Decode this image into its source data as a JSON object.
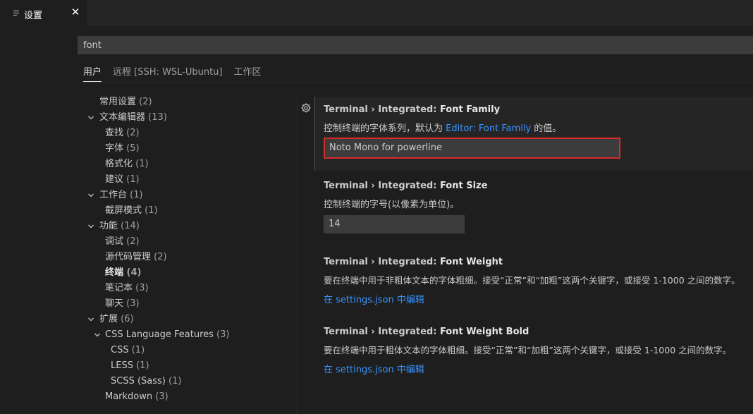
{
  "tab": {
    "label": "设置",
    "icon": "settings-list-icon",
    "close": "✕"
  },
  "search": {
    "value": "font"
  },
  "scopes": [
    {
      "label": "用户",
      "active": true
    },
    {
      "label": "远程 [SSH: WSL-Ubuntu]",
      "active": false
    },
    {
      "label": "工作区",
      "active": false
    }
  ],
  "toc": {
    "items": [
      {
        "label": "常用设置",
        "count": "(2)"
      },
      {
        "label": "文本编辑器",
        "count": "(13)",
        "chevron": "expanded"
      },
      {
        "label": "查找",
        "count": "(2)"
      },
      {
        "label": "字体",
        "count": "(5)"
      },
      {
        "label": "格式化",
        "count": "(1)"
      },
      {
        "label": "建议",
        "count": "(1)"
      },
      {
        "label": "工作台",
        "count": "(1)",
        "chevron": "expanded"
      },
      {
        "label": "截屏模式",
        "count": "(1)"
      },
      {
        "label": "功能",
        "count": "(14)",
        "chevron": "expanded"
      },
      {
        "label": "调试",
        "count": "(2)"
      },
      {
        "label": "源代码管理",
        "count": "(2)"
      },
      {
        "label": "终端",
        "count": "(4)",
        "selected": true
      },
      {
        "label": "笔记本",
        "count": "(3)"
      },
      {
        "label": "聊天",
        "count": "(3)"
      },
      {
        "label": "扩展",
        "count": "(6)",
        "chevron": "expanded"
      },
      {
        "label": "CSS Language Features",
        "count": "(3)",
        "chevron": "expanded"
      },
      {
        "label": "CSS",
        "count": "(1)"
      },
      {
        "label": "LESS",
        "count": "(1)"
      },
      {
        "label": "SCSS (Sass)",
        "count": "(1)"
      },
      {
        "label": "Markdown",
        "count": "(3)"
      }
    ]
  },
  "settings": [
    {
      "category": "Terminal › Integrated: ",
      "name": "Font Family",
      "desc_prefix": "控制终端的字体系列，默认为 ",
      "desc_link": "Editor: Font Family",
      "desc_suffix": " 的值。",
      "value": "Noto Mono for powerline"
    },
    {
      "category": "Terminal › Integrated: ",
      "name": "Font Size",
      "desc": "控制终端的字号(以像素为单位)。",
      "value": "14"
    },
    {
      "category": "Terminal › Integrated: ",
      "name": "Font Weight",
      "desc": "要在终端中用于非粗体文本的字体粗细。接受“正常”和“加粗”这两个关键字，或接受 1-1000 之间的数字。",
      "link": "在 settings.json 中编辑"
    },
    {
      "category": "Terminal › Integrated: ",
      "name": "Font Weight Bold",
      "desc": "要在终端中用于粗体文本的字体粗细。接受“正常”和“加粗”这两个关键字，或接受 1-1000 之间的数字。",
      "link": "在 settings.json 中编辑"
    }
  ],
  "colors": {
    "background": "#1e1e1e",
    "link": "#3794ff",
    "highlight_border": "#d62b2b"
  }
}
